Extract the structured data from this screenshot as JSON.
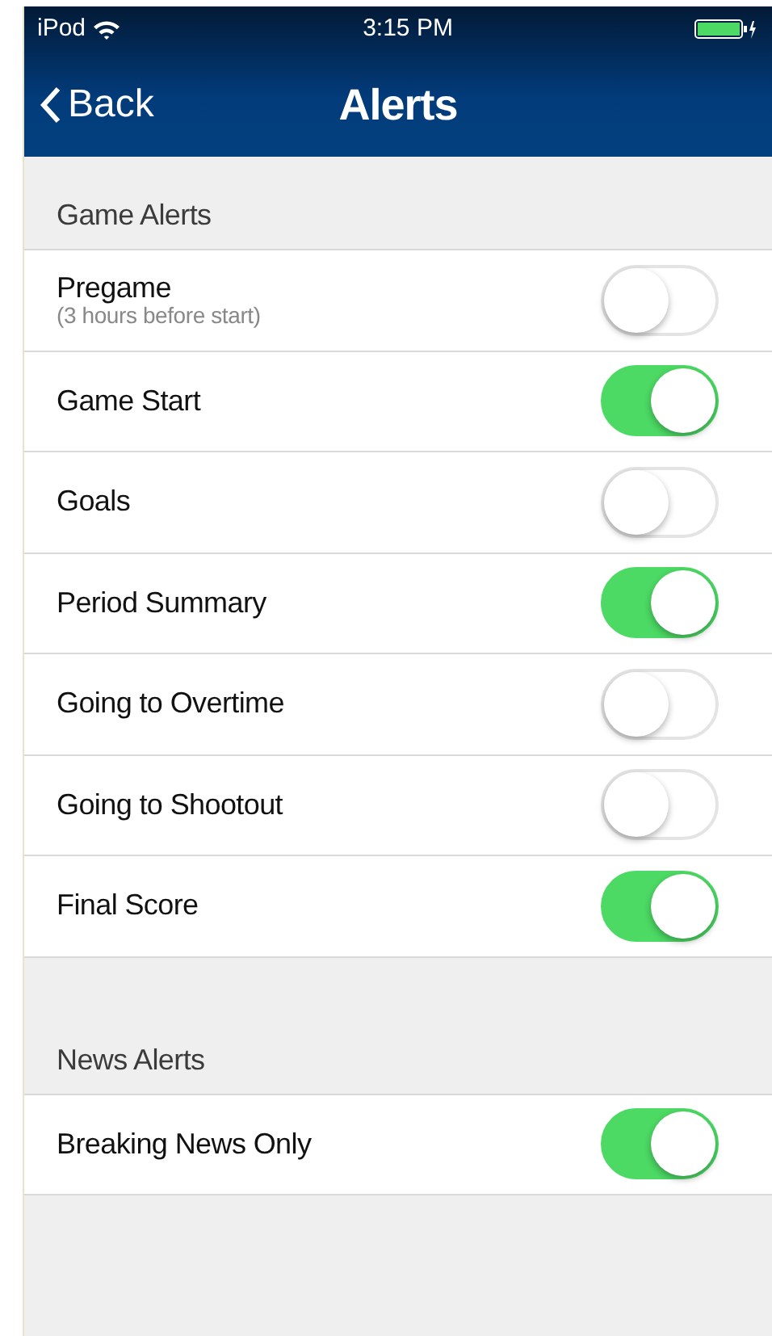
{
  "status_bar": {
    "carrier": "iPod",
    "time": "3:15 PM"
  },
  "nav_bar": {
    "back": "Back",
    "title": "Alerts"
  },
  "sections": [
    {
      "header": "Game Alerts",
      "rows": [
        {
          "label": "Pregame",
          "detail": "(3 hours before start)",
          "on": false
        },
        {
          "label": "Game Start",
          "on": true
        },
        {
          "label": "Goals",
          "on": false
        },
        {
          "label": "Period Summary",
          "on": true
        },
        {
          "label": "Going to Overtime",
          "on": false
        },
        {
          "label": "Going to Shootout",
          "on": false
        },
        {
          "label": "Final Score",
          "on": true
        }
      ]
    },
    {
      "header": "News Alerts",
      "rows": [
        {
          "label": "Breaking News Only",
          "on": true
        }
      ]
    }
  ]
}
